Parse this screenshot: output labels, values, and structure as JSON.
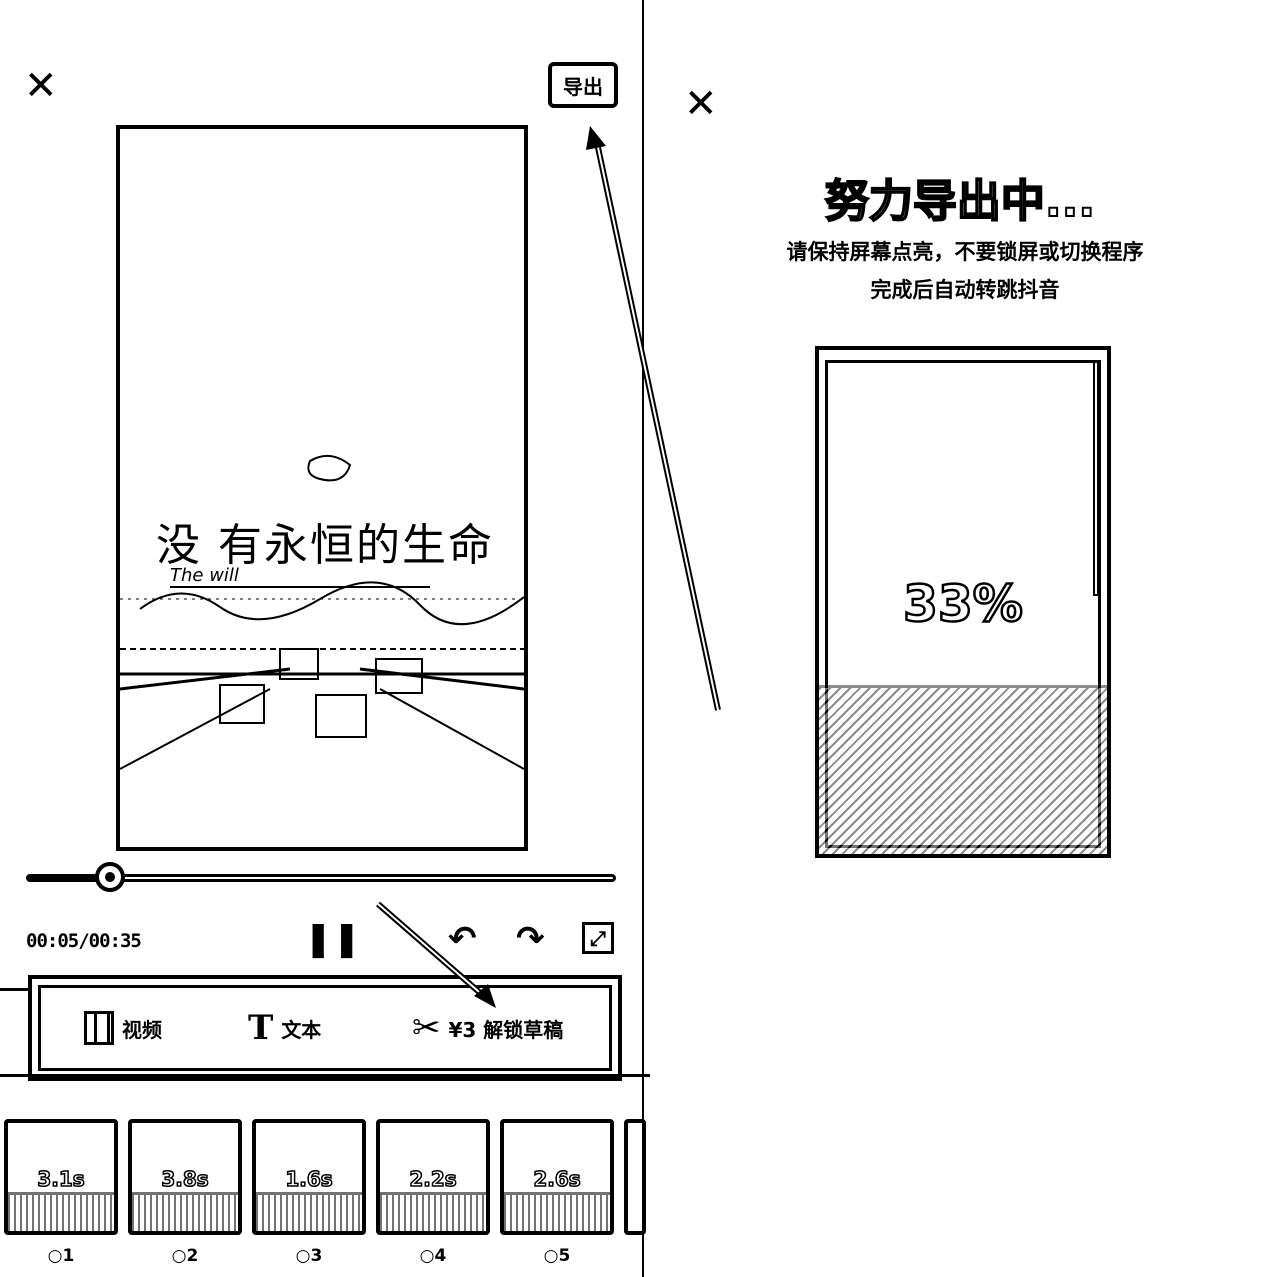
{
  "editor": {
    "close_icon": "close-icon",
    "export_label": "导出",
    "preview": {
      "title": "没 有永恒的生命",
      "subtitle": "The will"
    },
    "playback": {
      "progress": 0.143,
      "time": "00:05/00:35"
    },
    "controls": {
      "pause_icon": "pause-icon",
      "undo_icon": "undo-icon",
      "redo_icon": "redo-icon",
      "fullscreen_icon": "fullscreen-icon"
    },
    "toolbar": {
      "video_label": "视频",
      "text_label": "文本",
      "unlock_label": "¥3 解锁草稿"
    },
    "clips": [
      {
        "duration": "3.1s",
        "index": "1"
      },
      {
        "duration": "3.8s",
        "index": "2"
      },
      {
        "duration": "1.6s",
        "index": "3"
      },
      {
        "duration": "2.2s",
        "index": "4"
      },
      {
        "duration": "2.6s",
        "index": "5"
      }
    ]
  },
  "export_screen": {
    "title": "努力导出中...",
    "hint_line1": "请保持屏幕点亮，不要锁屏或切换程序",
    "hint_line2": "完成后自动转跳抖音",
    "percent": "33%",
    "progress": 0.33
  }
}
